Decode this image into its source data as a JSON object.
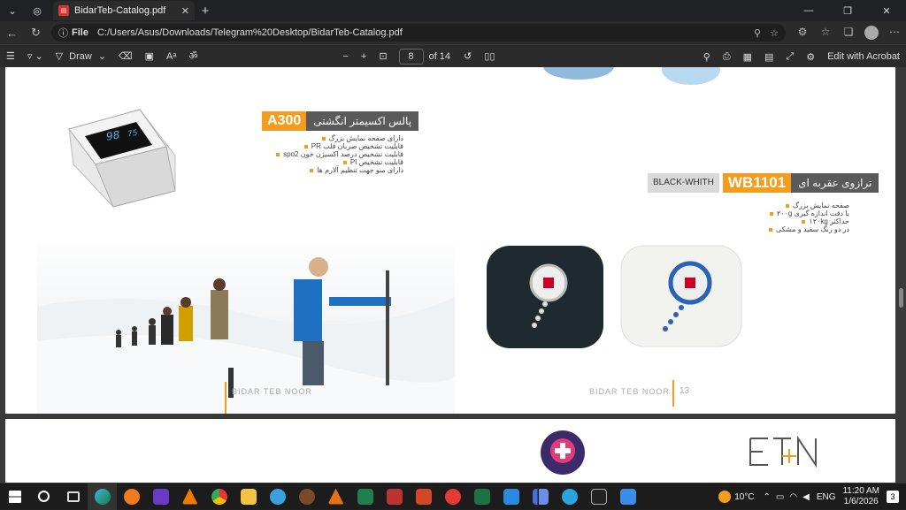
{
  "browser": {
    "tab_title": "BidarTeb-Catalog.pdf",
    "url_scheme": "File",
    "url": "C:/Users/Asus/Downloads/Telegram%20Desktop/BidarTeb-Catalog.pdf"
  },
  "pdf_toolbar": {
    "draw_label": "Draw",
    "page_current": "8",
    "page_total": "of 14",
    "edit_label": "Edit with Acrobat"
  },
  "page1": {
    "oximeter": {
      "model": "A300",
      "title": "پالس اکسیمتر انگشتی",
      "features": [
        "دارای صفحه نمایش بزرگ",
        "قابلیت تشخیص ضربان قلب PR",
        "قابلیت تشخیص درصد اکسیژن خون spo2",
        "قابلیت تشخیص PI",
        "دارای منو جهت تنظیم آلارم ها"
      ]
    },
    "scale": {
      "model": "WB1101",
      "title": "ترازوی عقربه ای",
      "tag": "BLACK-WHITH",
      "features": [
        "صفحه نمایش بزرگ",
        "با دقت اندازه گیری ۲۰۰g",
        "حداکثر ۱۲۰kg",
        "در دو رنگ سفید و مشکی"
      ]
    },
    "footer_left": "BIDAR TEB NOOR",
    "footer_right": "BIDAR TEB NOOR",
    "page_number": "13"
  },
  "taskbar": {
    "weather": "10°C",
    "language": "ENG",
    "time": "11:20 AM",
    "date": "1/6/2026",
    "notification_count": "3"
  }
}
